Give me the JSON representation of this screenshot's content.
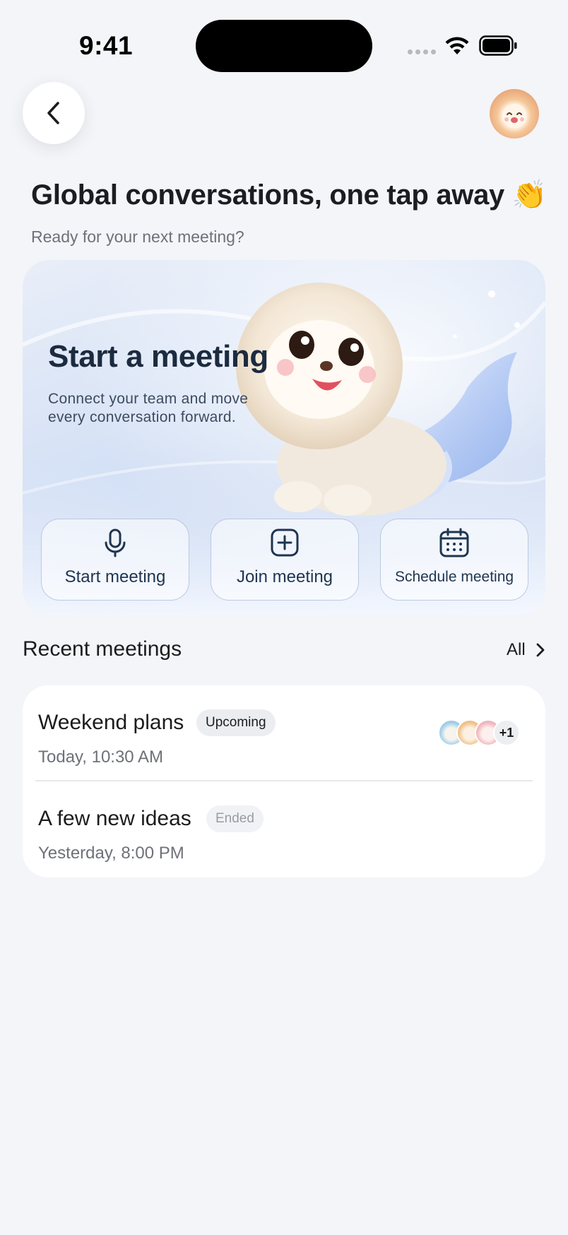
{
  "status_bar": {
    "time": "9:41",
    "icons": [
      "cellular-signal-icon",
      "wifi-icon",
      "battery-icon"
    ]
  },
  "header": {
    "back_icon": "chevron-left-icon",
    "profile_avatar": "lion-avatar"
  },
  "page": {
    "title": "Global conversations, one tap away 👏",
    "subtitle": "Ready for your next meeting?"
  },
  "hero": {
    "title": "Start a meeting",
    "description": "Connect your team and move every conversation forward.",
    "illustration": "lion-mermaid-mascot",
    "actions": [
      {
        "label": "Start meeting",
        "icon": "microphone-icon"
      },
      {
        "label": "Join meeting",
        "icon": "plus-square-icon"
      },
      {
        "label": "Schedule meeting",
        "icon": "calendar-icon"
      }
    ]
  },
  "recent": {
    "title": "Recent meetings",
    "all_label": "All",
    "meetings": [
      {
        "title": "Weekend plans",
        "status": "Upcoming",
        "time": "Today, 10:30 AM",
        "participants_extra": "+1"
      },
      {
        "title": "A few new ideas",
        "status": "Ended",
        "time": "Yesterday, 8:00 PM"
      }
    ]
  },
  "colors": {
    "background": "#f4f5f8",
    "card": "#ffffff",
    "hero_text": "#1c2b3f",
    "action_text": "#1e3550",
    "muted_text": "#6f7178"
  }
}
